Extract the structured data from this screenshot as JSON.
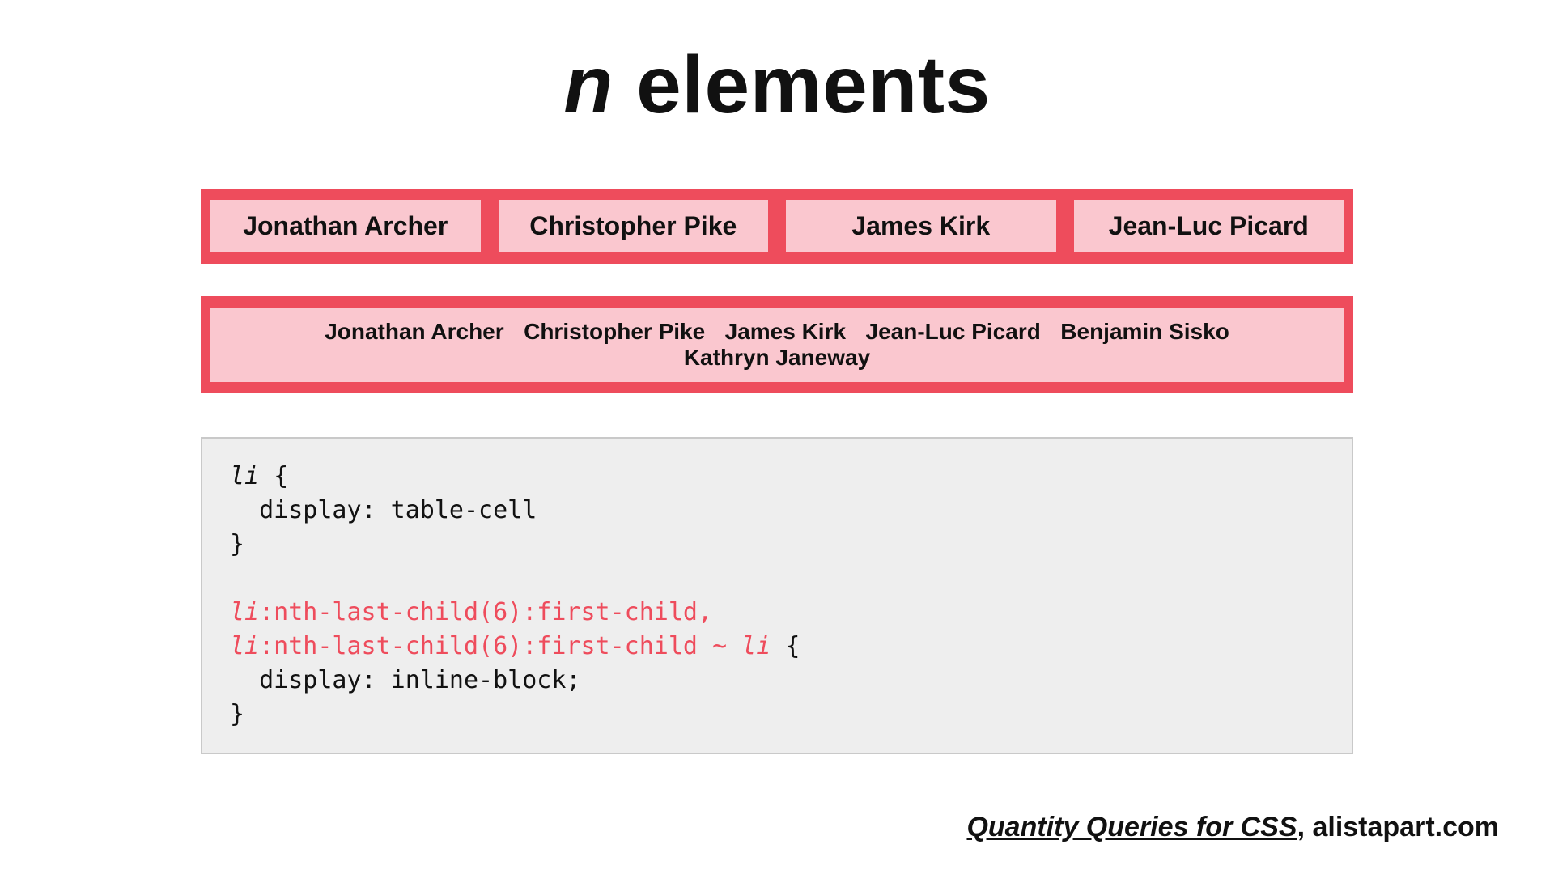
{
  "title_n": "n",
  "title_rest": " elements",
  "row1": [
    "Jonathan Archer",
    "Christopher Pike",
    "James Kirk",
    "Jean-Luc Picard"
  ],
  "row2": [
    "Jonathan Archer",
    "Christopher Pike",
    "James Kirk",
    "Jean-Luc Picard",
    "Benjamin Sisko",
    "Kathryn Janeway"
  ],
  "code": {
    "l1a": "li",
    "l1b": " {",
    "l2": "  display: table-cell",
    "l3": "}",
    "l4": "",
    "l5a": "li",
    "l5b": ":nth-last-child(6):first-child,",
    "l6a": "li",
    "l6b": ":nth-last-child(6):first-child ~ ",
    "l6c": "li",
    "l6d": " {",
    "l7": "  display: inline-block;",
    "l8": "}"
  },
  "citation": {
    "link": "Quantity Queries for CSS",
    "sep": ", ",
    "site": "alistapart.com"
  }
}
